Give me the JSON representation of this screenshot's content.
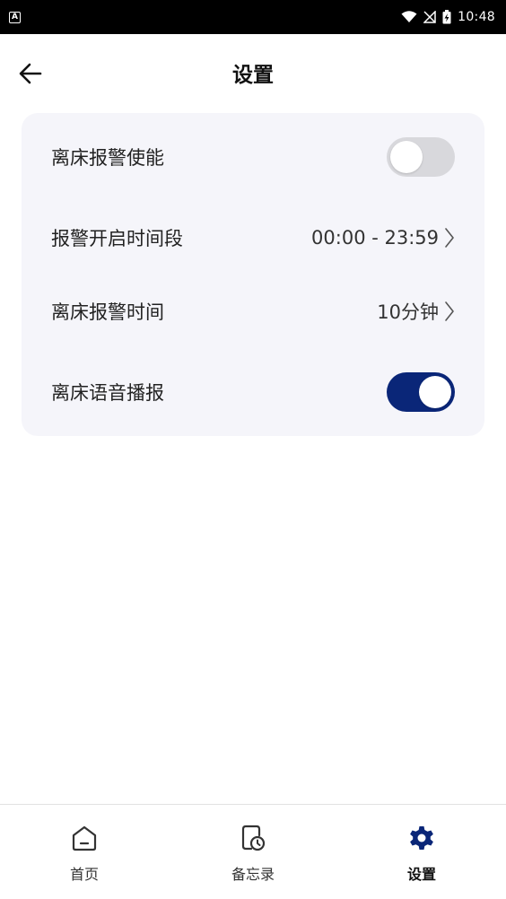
{
  "status_bar": {
    "notification_icon": "a-icon",
    "time": "10:48"
  },
  "header": {
    "title": "设置",
    "back_icon": "arrow-left-icon"
  },
  "settings": {
    "bed_exit_alarm_enable": {
      "label": "离床报警使能",
      "enabled": false
    },
    "alarm_time_period": {
      "label": "报警开启时间段",
      "value": "00:00 - 23:59"
    },
    "bed_exit_alarm_time": {
      "label": "离床报警时间",
      "value": "10分钟"
    },
    "bed_exit_voice": {
      "label": "离床语音播报",
      "enabled": true
    }
  },
  "bottom_nav": {
    "items": [
      {
        "label": "首页",
        "icon": "home-icon",
        "active": false
      },
      {
        "label": "备忘录",
        "icon": "memo-clock-icon",
        "active": false
      },
      {
        "label": "设置",
        "icon": "gear-icon",
        "active": true
      }
    ]
  },
  "colors": {
    "accent": "#0a2678",
    "toggle_off": "#d8d8dc",
    "card_bg": "#f5f5fa"
  }
}
